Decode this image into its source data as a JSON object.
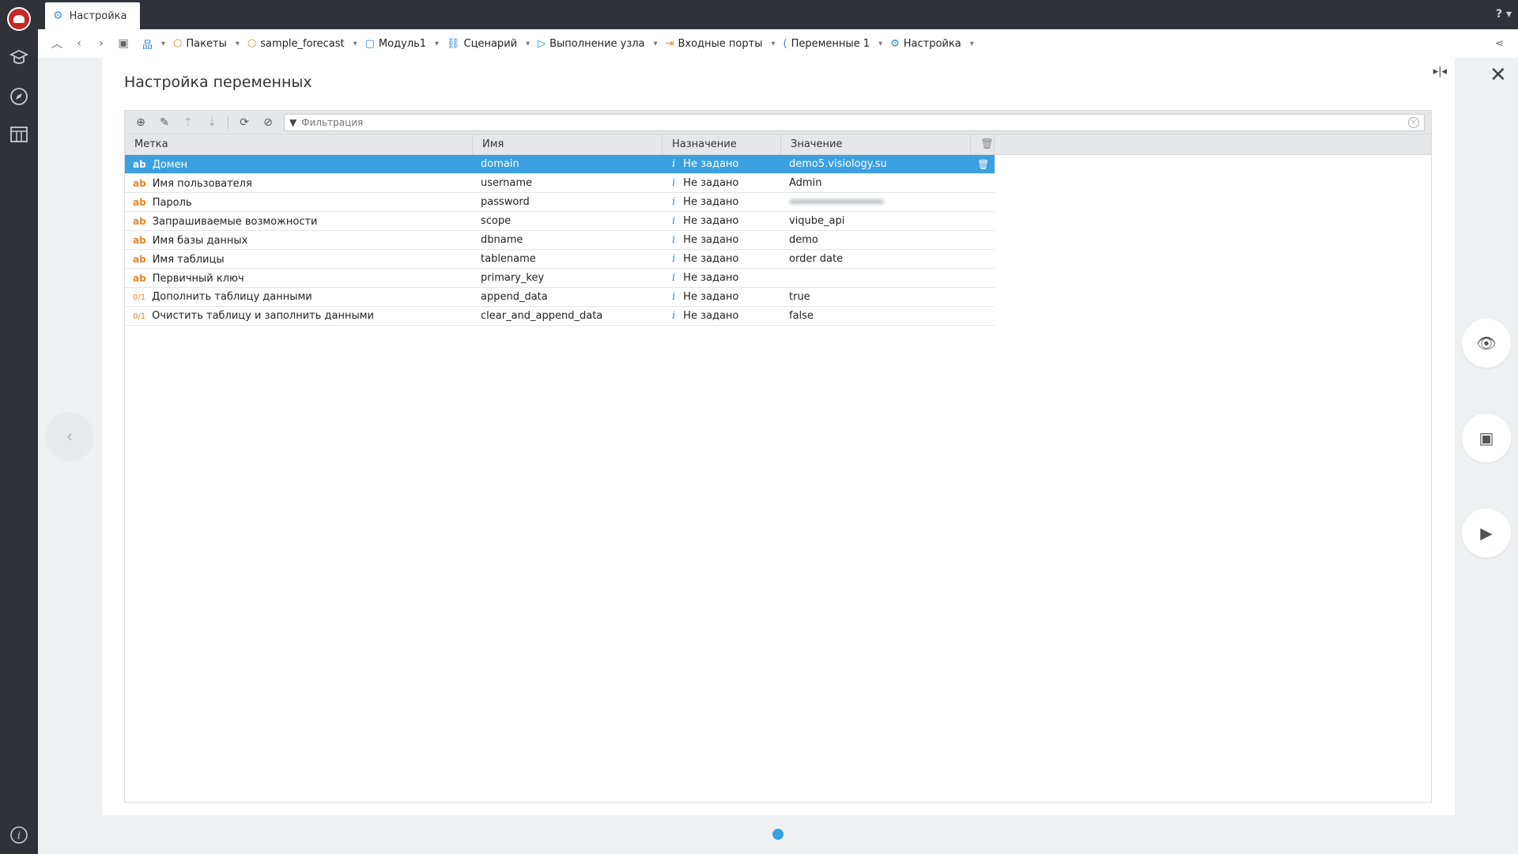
{
  "app": {
    "tab_title": "Настройка",
    "help_label": "?"
  },
  "breadcrumbs": [
    {
      "label": "Пакеты",
      "icon": "package-icon"
    },
    {
      "label": "sample_forecast",
      "icon": "package-icon"
    },
    {
      "label": "Модуль1",
      "icon": "module-icon"
    },
    {
      "label": "Сценарий",
      "icon": "scenario-icon"
    },
    {
      "label": "Выполнение узла",
      "icon": "run-icon"
    },
    {
      "label": "Входные порты",
      "icon": "input-ports-icon"
    },
    {
      "label": "Переменные 1",
      "icon": "variables-icon"
    },
    {
      "label": "Настройка",
      "icon": "gear-icon"
    }
  ],
  "page": {
    "title": "Настройка переменных"
  },
  "filter": {
    "placeholder": "Фильтрация"
  },
  "table": {
    "columns": [
      "Метка",
      "Имя",
      "Назначение",
      "Значение"
    ],
    "rows": [
      {
        "type": "ab",
        "label": "Домен",
        "name": "domain",
        "purpose": "Не задано",
        "value": "demo5.visiology.su"
      },
      {
        "type": "ab",
        "label": "Имя пользователя",
        "name": "username",
        "purpose": "Не задано",
        "value": "Admin"
      },
      {
        "type": "ab",
        "label": "Пароль",
        "name": "password",
        "purpose": "Не задано",
        "value": ""
      },
      {
        "type": "ab",
        "label": "Запрашиваемые возможности",
        "name": "scope",
        "purpose": "Не задано",
        "value": "viqube_api"
      },
      {
        "type": "ab",
        "label": "Имя базы данных",
        "name": "dbname",
        "purpose": "Не задано",
        "value": "demo"
      },
      {
        "type": "ab",
        "label": "Имя таблицы",
        "name": "tablename",
        "purpose": "Не задано",
        "value": "order date"
      },
      {
        "type": "ab",
        "label": "Первичный ключ",
        "name": "primary_key",
        "purpose": "Не задано",
        "value": ""
      },
      {
        "type": "0/1",
        "label": "Дополнить таблицу данными",
        "name": "append_data",
        "purpose": "Не задано",
        "value": "true"
      },
      {
        "type": "0/1",
        "label": "Очистить таблицу и заполнить данными",
        "name": "clear_and_append_data",
        "purpose": "Не задано",
        "value": "false"
      }
    ]
  },
  "colors": {
    "accent": "#3aa0e0",
    "type_badge": "#e5872a",
    "sidebar": "#2f3238"
  }
}
